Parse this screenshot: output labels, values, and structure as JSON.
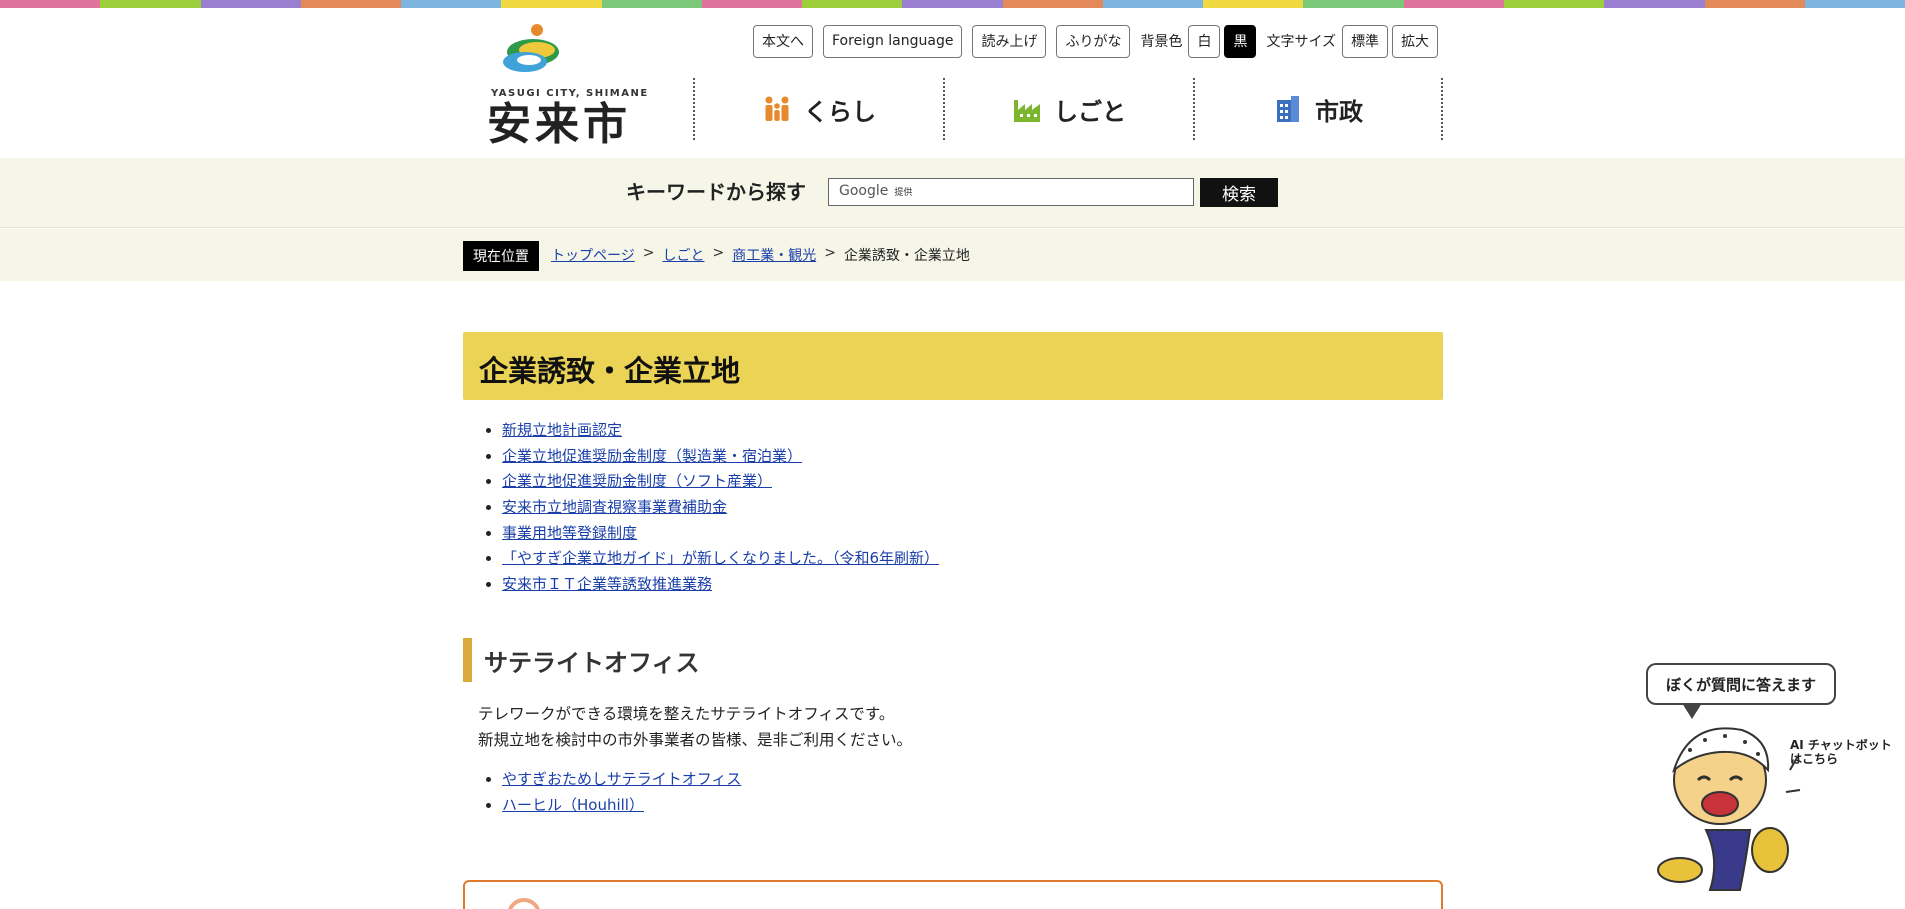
{
  "colors": {
    "top_stripe": [
      "#e0729e",
      "#9dcf3c",
      "#9a7fd0",
      "#e38a5a",
      "#7db4e0",
      "#f0d840",
      "#7cc87a",
      "#e0729e",
      "#9dcf3c",
      "#9a7fd0",
      "#e38a5a",
      "#7db4e0",
      "#f0d840",
      "#7cc87a",
      "#e0729e",
      "#9dcf3c",
      "#9a7fd0",
      "#e38a5a",
      "#7db4e0"
    ],
    "title_bg": "#ebd356",
    "h2_accent": "#d9a93c",
    "link": "#1a3fa8"
  },
  "logo": {
    "en": "YASUGI CITY, SHIMANE",
    "ja": "安来市"
  },
  "utility": {
    "skip": "本文へ",
    "foreign": "Foreign language",
    "read_aloud": "読み上げ",
    "furigana": "ふりがな",
    "bg_label": "背景色",
    "bg_white": "白",
    "bg_black": "黒",
    "size_label": "文字サイズ",
    "size_standard": "標準",
    "size_large": "拡大"
  },
  "gnav": [
    {
      "label": "くらし",
      "icon": "people-icon"
    },
    {
      "label": "しごと",
      "icon": "factory-icon"
    },
    {
      "label": "市政",
      "icon": "building-icon"
    }
  ],
  "search": {
    "label": "キーワードから探す",
    "placeholder": "Google",
    "placeholder_sub": "提供",
    "button": "検索"
  },
  "breadcrumb": {
    "label": "現在位置",
    "items": [
      "トップページ",
      "しごと",
      "商工業・観光"
    ],
    "current": "企業誘致・企業立地"
  },
  "page": {
    "title": "企業誘致・企業立地",
    "links": [
      "新規立地計画認定",
      "企業立地促進奨励金制度（製造業・宿泊業）",
      "企業立地促進奨励金制度（ソフト産業）",
      "安来市立地調査視察事業費補助金",
      "事業用地等登録制度",
      "「やすぎ企業立地ガイド」が新しくなりました。（令和6年刷新）",
      "安来市ＩＴ企業等誘致推進業務"
    ],
    "section_title": "サテライトオフィス",
    "section_text_1": "テレワークができる環境を整えたサテライトオフィスです。",
    "section_text_2": "新規立地を検討中の市外事業者の皆様、是非ご利用ください。",
    "section_links": [
      "やすぎおためしサテライトオフィス",
      "ハーヒル（Houhill）"
    ]
  },
  "chatbot": {
    "bubble": "ぼくが質問に答えます",
    "note_1": "AI チャットボット",
    "note_2": "はこちら"
  }
}
